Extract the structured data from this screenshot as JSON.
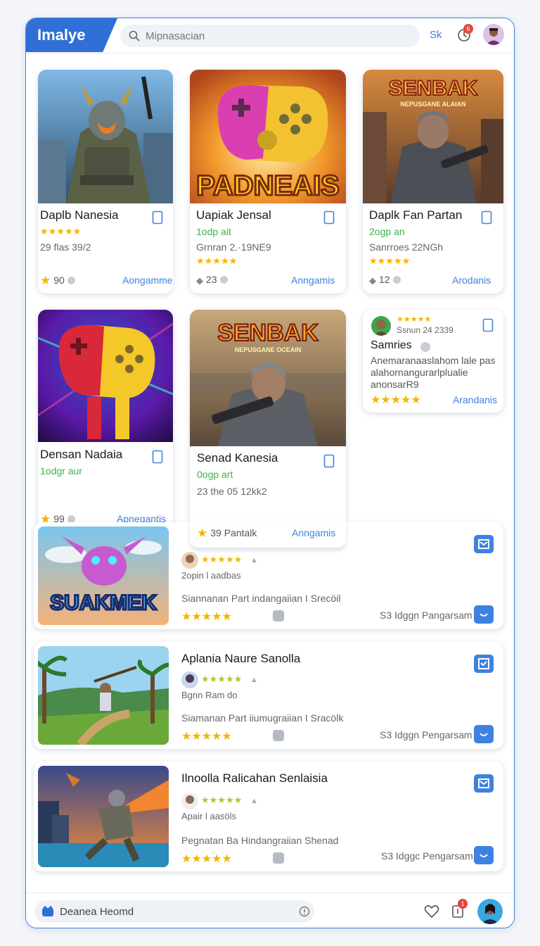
{
  "header": {
    "logo": "Imalye",
    "search_placeholder": "Mipnasacian",
    "sk_label": "Sk",
    "notification_count": "6"
  },
  "grid_cards": [
    {
      "title": "Daplb Nanesia",
      "stars": "★★★★★",
      "meta": "29 flas 39/2",
      "rating": "90",
      "link": "Aongamme"
    },
    {
      "title": "Uapiak Jensal",
      "subtitle": "1odp ait",
      "meta": "Grnran 2.·19NE9",
      "stars": "★★★★★",
      "rating": "23",
      "link": "Anngamis"
    },
    {
      "title": "Daplk Fan Partan",
      "subtitle": "2ogp an",
      "meta": "Sanrroes 22NGh",
      "stars": "★★★★★",
      "rating": "12",
      "link": "Arodanis"
    },
    {
      "title": "Densan Nadaia",
      "subtitle": "1odgr aur",
      "rating": "99",
      "link": "Apnegantis"
    },
    {
      "title": "Senad Kanesia",
      "subtitle": "0ogp art",
      "meta": "23 the 05 12kk2",
      "rating": "39 Pantalk",
      "link": "Anngamis"
    },
    {
      "title": "Samries",
      "stars": "★★★★★",
      "meta_top": "Ssnun 24 2339",
      "description": "Anemaranaaslahom lale pas alahornangurarlplualie anonsarR9",
      "stars_bottom": "★★★★★",
      "link": "Arandanis"
    }
  ],
  "art_text": {
    "card3": [
      "SENBAK",
      "NEPUSGANE ALAIAN"
    ],
    "card2": "PADNEAIS",
    "card5": [
      "SENBAK",
      "NEPUSGANE OCEAIN"
    ],
    "list1": "SUAKMEK"
  },
  "list_cards": [
    {
      "title": "",
      "stars": "★★★★★",
      "sub": "2opin l aadbas",
      "desc": "Siannanan Part indangaiian I Srecöil",
      "stars_bottom": "★★★★★",
      "right_text": "S3 Idggn Pangarsam"
    },
    {
      "title": "Aplania Naure Sanolla",
      "stars": "★★★★★",
      "sub": "Bgnn Ram do",
      "desc": "Siamanan Part iiumugraiian I Sracölk",
      "stars_bottom": "★★★★★",
      "right_text": "S3 Idggn Pengarsam"
    },
    {
      "title": "Ilnoolla Ralicahan Senlaisia",
      "stars": "★★★★★",
      "sub": "Apair l aasöls",
      "desc": "Pegnatan Ba Hindangraiian Shenad",
      "stars_bottom": "★★★★★",
      "right_text": "S3 Idggc Pengarsam"
    }
  ],
  "bottom": {
    "input_value": "Deanea Heomd",
    "notification_count": "1"
  },
  "colors": {
    "accent": "#3d82e0",
    "star": "#f4b400",
    "green": "#3bb34a",
    "logo_bg": "#2f6fd6"
  }
}
